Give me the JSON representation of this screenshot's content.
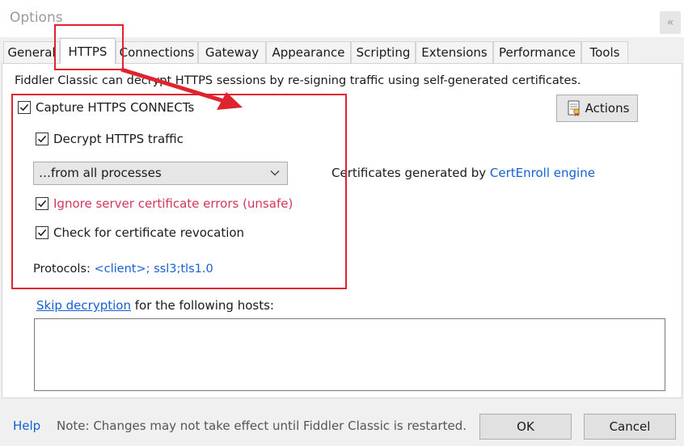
{
  "window": {
    "title": "Options",
    "close_label": "«"
  },
  "tabs": [
    {
      "label": "General"
    },
    {
      "label": "HTTPS",
      "active": true
    },
    {
      "label": "Connections"
    },
    {
      "label": "Gateway"
    },
    {
      "label": "Appearance"
    },
    {
      "label": "Scripting"
    },
    {
      "label": "Extensions"
    },
    {
      "label": "Performance"
    },
    {
      "label": "Tools"
    }
  ],
  "https": {
    "intro": "Fiddler Classic can decrypt HTTPS sessions by re-signing traffic using self-generated certificates.",
    "capture_connects": {
      "label": "Capture HTTPS CONNECTs",
      "checked": true
    },
    "decrypt_traffic": {
      "label": "Decrypt HTTPS traffic",
      "checked": true
    },
    "process_filter": {
      "selected": "…from all processes"
    },
    "ignore_errors": {
      "label": "Ignore server certificate errors (unsafe)",
      "checked": true
    },
    "check_revocation": {
      "label": "Check for certificate revocation",
      "checked": true
    },
    "cert_note_prefix": "Certificates generated by ",
    "cert_engine_link": "CertEnroll engine",
    "actions_label": "Actions",
    "protocols_label": "Protocols: ",
    "protocols_value": "<client>; ssl3;tls1.0",
    "skip_link": "Skip decryption",
    "skip_suffix": " for the following hosts:",
    "hosts_value": ""
  },
  "footer": {
    "help": "Help",
    "note": "Note: Changes may not take effect until Fiddler Classic is restarted.",
    "ok": "OK",
    "cancel": "Cancel"
  },
  "colors": {
    "accent_link": "#1560d4",
    "danger_text": "#d2375a",
    "annotation_red": "#e0242f"
  },
  "icons": {
    "actions": "certificate-document-icon",
    "dropdown": "chevron-down-icon",
    "checkbox": "checkmark-icon"
  }
}
